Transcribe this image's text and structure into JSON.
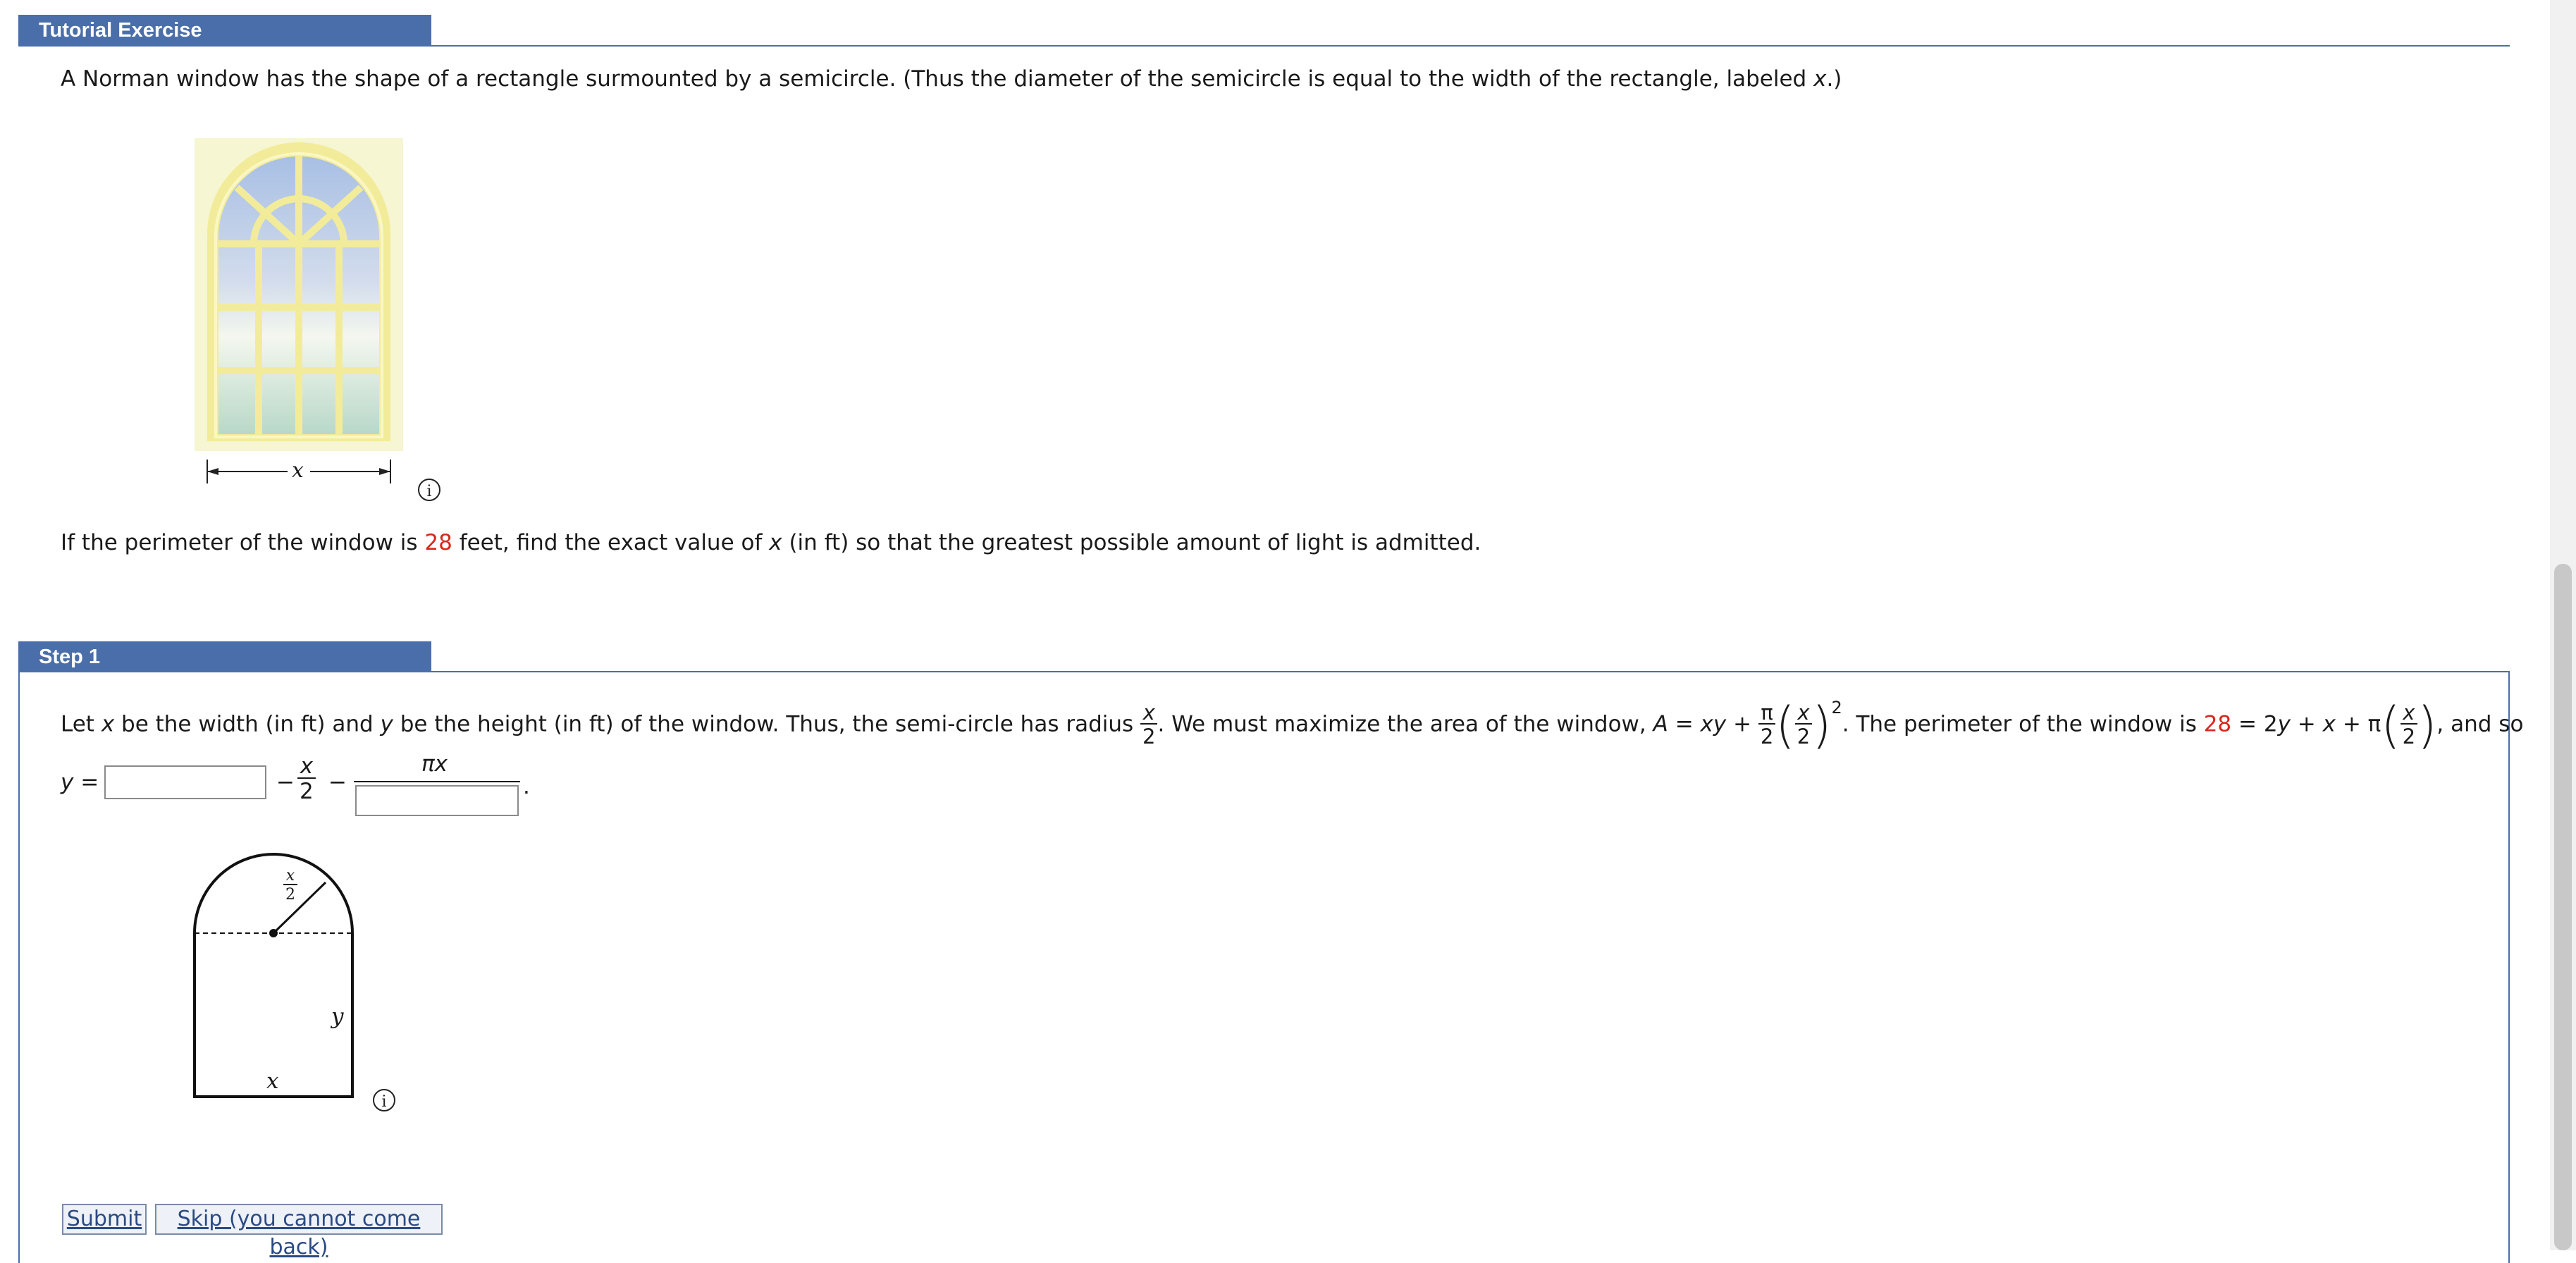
{
  "tutorial": {
    "header": "Tutorial Exercise",
    "intro_a": "A Norman window has the shape of a rectangle surmounted by a semicircle. (Thus the diameter of the semicircle is equal to the width of the rectangle, labeled ",
    "intro_var": "x",
    "intro_b": ".)",
    "figure_label": "x",
    "question_a": "If the perimeter of the window is ",
    "perimeter": "28",
    "question_b": " feet, find the exact value of ",
    "question_var": "x",
    "question_c": " (in ft) so that the greatest possible amount of light is admitted."
  },
  "step1": {
    "header": "Step 1",
    "line_a": "Let ",
    "var_x": "x",
    "line_b": " be the width (in ft) and ",
    "var_y": "y",
    "line_c": " be the height (in ft) of the window. Thus, the semi-circle has radius ",
    "radius_num": "x",
    "radius_den": "2",
    "line_d": ". We must maximize the area of the window, ",
    "area_lhs": "A",
    "area_eq": " = ",
    "area_xy": "xy",
    "area_plus": " + ",
    "area_pi": "π",
    "area_two": "2",
    "area_x": "x",
    "area_two2": "2",
    "area_exp": "2",
    "line_e": ". The perimeter of the window is ",
    "perimeter": "28",
    "perim_eq": " = 2",
    "perim_y": "y",
    "perim_mid": " + ",
    "perim_x": "x",
    "perim_plus": " + π",
    "perim_fx": "x",
    "perim_f2": "2",
    "line_f": ", and so",
    "y_var": "y",
    "y_eq": " = ",
    "minus1": "−",
    "frac_x": "x",
    "frac_2": "2",
    "minus2": "−",
    "pix": "πx",
    "period": ".",
    "fig_r_num": "x",
    "fig_r_den": "2",
    "fig_y": "y",
    "fig_x": "x"
  },
  "buttons": {
    "submit": "Submit",
    "skip": "Skip (you cannot come back)"
  },
  "info_icon": "i",
  "colors": {
    "header": "#4a6ea9",
    "accent_red": "#d8281c"
  }
}
